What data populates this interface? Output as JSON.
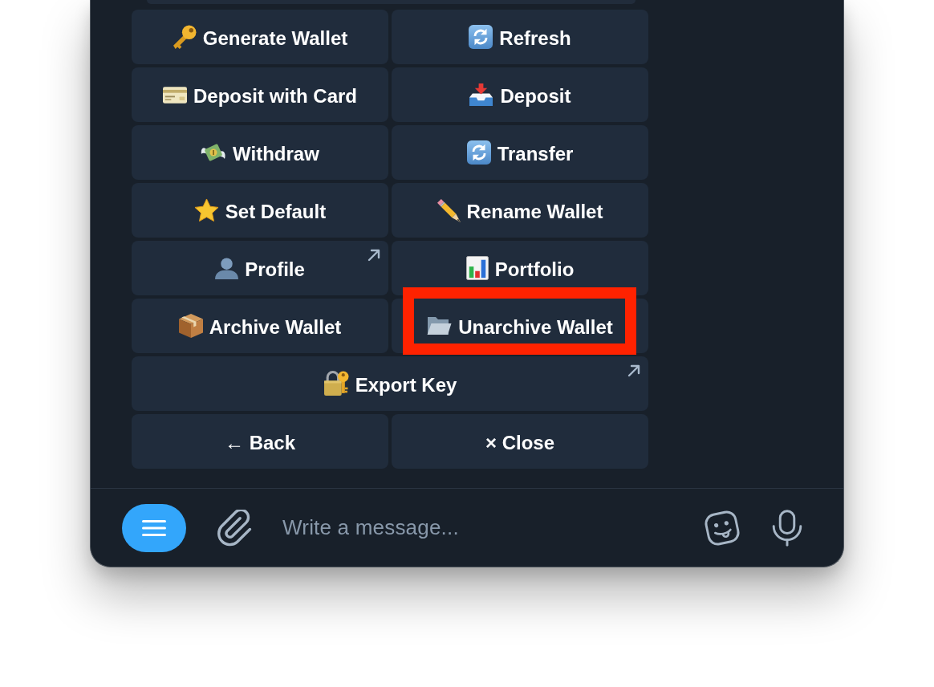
{
  "keyboard": {
    "rows": [
      [
        {
          "label": "Generate Wallet",
          "external": false,
          "highlighted": false
        },
        {
          "label": "Refresh",
          "external": false,
          "highlighted": false
        }
      ],
      [
        {
          "label": "Deposit with Card",
          "external": false,
          "highlighted": false
        },
        {
          "label": "Deposit",
          "external": false,
          "highlighted": false
        }
      ],
      [
        {
          "label": "Withdraw",
          "external": false,
          "highlighted": false
        },
        {
          "label": "Transfer",
          "external": false,
          "highlighted": false
        }
      ],
      [
        {
          "label": "Set Default",
          "external": false,
          "highlighted": false
        },
        {
          "label": "Rename Wallet",
          "external": false,
          "highlighted": false
        }
      ],
      [
        {
          "label": "Profile",
          "external": true,
          "highlighted": false
        },
        {
          "label": "Portfolio",
          "external": false,
          "highlighted": false
        }
      ],
      [
        {
          "label": "Archive Wallet",
          "external": false,
          "highlighted": false
        },
        {
          "label": "Unarchive Wallet",
          "external": false,
          "highlighted": true
        }
      ],
      [
        {
          "label": "Export Key",
          "external": true,
          "highlighted": false
        }
      ],
      [
        {
          "label": "← Back",
          "external": false,
          "highlighted": false
        },
        {
          "label": "× Close",
          "external": false,
          "highlighted": false
        }
      ]
    ]
  },
  "composer": {
    "placeholder": "Write a message..."
  }
}
